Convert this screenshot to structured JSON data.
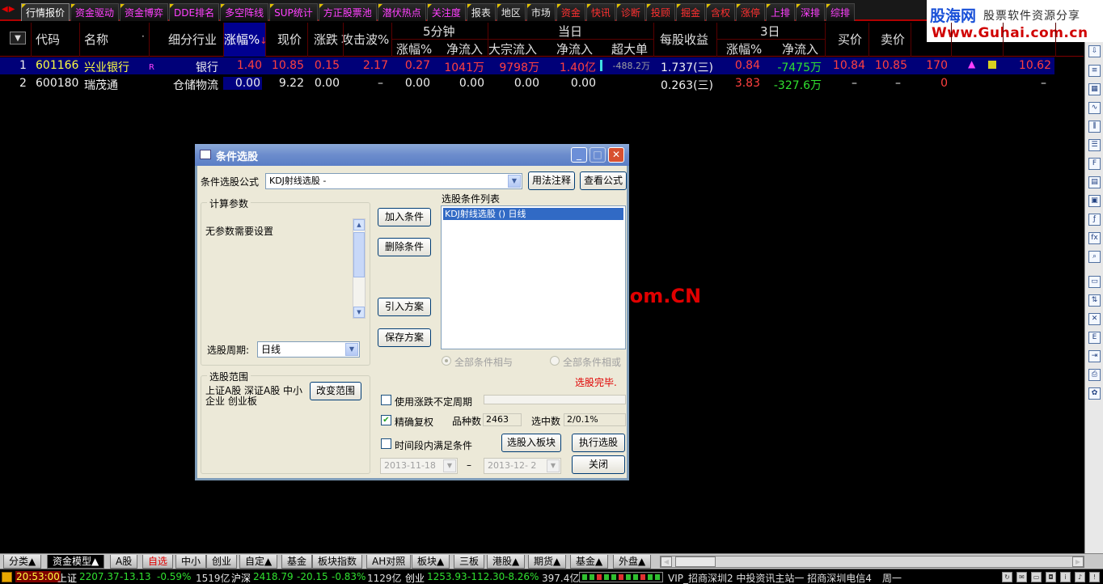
{
  "top_tabs": [
    {
      "label": "行情报价",
      "color": "white",
      "active": true
    },
    {
      "label": "资金驱动",
      "color": "mag"
    },
    {
      "label": "资金博弈",
      "color": "mag"
    },
    {
      "label": "DDE排名",
      "color": "mag"
    },
    {
      "label": "多空阵线",
      "color": "mag"
    },
    {
      "label": "SUP统计",
      "color": "mag"
    },
    {
      "label": "方正股票池",
      "color": "mag"
    },
    {
      "label": "潜伏热点",
      "color": "mag"
    },
    {
      "label": "关注度",
      "color": "mag"
    },
    {
      "label": "报表",
      "color": "white"
    },
    {
      "label": "地区",
      "color": "white"
    },
    {
      "label": "市场",
      "color": "white"
    },
    {
      "label": "资金",
      "color": "red"
    },
    {
      "label": "快讯",
      "color": "red"
    },
    {
      "label": "诊断",
      "color": "red"
    },
    {
      "label": "投顾",
      "color": "red"
    },
    {
      "label": "掘金",
      "color": "red"
    },
    {
      "label": "含权",
      "color": "red"
    },
    {
      "label": "涨停",
      "color": "red"
    },
    {
      "label": "上排",
      "color": "mag"
    },
    {
      "label": "深排",
      "color": "mag"
    },
    {
      "label": "综排",
      "color": "mag"
    }
  ],
  "logo": {
    "brand": "股海网",
    "tagline": "股票软件资源分享",
    "url": "Www.Guhai.com.cn"
  },
  "header": {
    "code": "代码",
    "name": "名称",
    "dot": "·",
    "industry": "细分行业",
    "change_pct": "涨幅%",
    "price": "现价",
    "change": "涨跌",
    "attack_wave": "攻击波%",
    "five_min": "5分钟",
    "five_min_change": "涨幅%",
    "five_min_inflow": "净流入",
    "today": "当日",
    "block_inflow": "大宗流入",
    "today_inflow": "净流入",
    "super_large": "超大单",
    "eps": "每股收益",
    "three_day": "3日",
    "three_day_change": "涨幅%",
    "three_day_inflow": "净流入",
    "bid": "买价",
    "ask": "卖价"
  },
  "rows": [
    {
      "idx": "1",
      "code": "601166",
      "name": "兴业银行",
      "flag": "R",
      "industry": "银行",
      "change_pct": "1.40",
      "price": "10.85",
      "change": "0.15",
      "attack": "2.17",
      "m5_change": "0.27",
      "m5_inflow": "1041万",
      "block_inflow": "9798万",
      "today_inflow": "1.40亿",
      "super_large": "-488.2万",
      "eps": "1.737(三)",
      "d3_change": "0.84",
      "d3_inflow": "-7475万",
      "bid": "10.84",
      "ask": "10.85",
      "volume": "170",
      "last": "10.62"
    },
    {
      "idx": "2",
      "code": "600180",
      "name": "瑞茂通",
      "flag": "",
      "industry": "仓储物流",
      "change_pct": "0.00",
      "price": "9.22",
      "change": "0.00",
      "attack": "–",
      "m5_change": "0.00",
      "m5_inflow": "0.00",
      "block_inflow": "0.00",
      "today_inflow": "0.00",
      "super_large": "",
      "eps": "0.263(三)",
      "d3_change": "3.83",
      "d3_inflow": "-327.6万",
      "bid": "–",
      "ask": "–",
      "volume": "0",
      "last": "–"
    }
  ],
  "watermark": "股海网 Www.Guhai.Com.CN",
  "dialog": {
    "title": "条件选股",
    "formula_label": "条件选股公式",
    "formula_value": "KDJ射线选股 -",
    "usage_button": "用法注释",
    "view_formula_button": "查看公式",
    "params_group": "计算参数",
    "params_text": "无参数需要设置",
    "period_label": "选股周期:",
    "period_value": "日线",
    "scope_group": "选股范围",
    "scope_text": "上证A股 深证A股 中小企业 创业板",
    "change_scope_button": "改变范围",
    "add_button": "加入条件",
    "delete_button": "删除条件",
    "import_button": "引入方案",
    "save_button": "保存方案",
    "conditions_label": "选股条件列表",
    "conditions": [
      "KDJ射线选股 () 日线"
    ],
    "radio_and": "全部条件相与",
    "radio_or": "全部条件相或",
    "done_text": "选股完毕.",
    "use_variable_period": "使用涨跌不定周期",
    "precise_adjust": "精确复权",
    "count_label": "品种数",
    "count_value": "2463",
    "selected_label": "选中数",
    "selected_value": "2/0.1%",
    "time_range": "时间段内满足条件",
    "to_block_button": "选股入板块",
    "execute_button": "执行选股",
    "date_from": "2013-11-18",
    "date_sep": "–",
    "date_to": "2013-12- 2",
    "close_button": "关闭"
  },
  "bottom_tabs": [
    {
      "label": "分类▲"
    },
    {
      "label": "资金模型▲",
      "active": true
    },
    {
      "label": "A股"
    },
    {
      "label": "自选",
      "red": true
    },
    {
      "label": "中小"
    },
    {
      "label": "创业"
    },
    {
      "label": "自定▲"
    },
    {
      "label": "基金"
    },
    {
      "label": "板块指数"
    },
    {
      "label": "AH对照"
    },
    {
      "label": "板块▲"
    },
    {
      "label": "三板"
    },
    {
      "label": "港股▲"
    },
    {
      "label": "期货▲"
    },
    {
      "label": "基金▲"
    },
    {
      "label": "外盘▲"
    }
  ],
  "status": {
    "time": "20:53:00",
    "sh_label": "上证",
    "sh_index": "2207.37",
    "sh_change": "-13.13",
    "sh_pct": "-0.59%",
    "sh_amount": "1519亿",
    "sz_label": "沪深",
    "sz_index": "2418.79",
    "sz_change": "-20.15",
    "sz_pct": "-0.83%",
    "sz_amount": "1129亿",
    "cy_label": "创业",
    "cy_index": "1253.93",
    "cy_change": "-112.30",
    "cy_pct": "-8.26%",
    "cy_amount": "397.4亿",
    "server": "VIP_招商深圳2 中投资讯主站一 招商深圳电信4",
    "weekday": "周一"
  }
}
